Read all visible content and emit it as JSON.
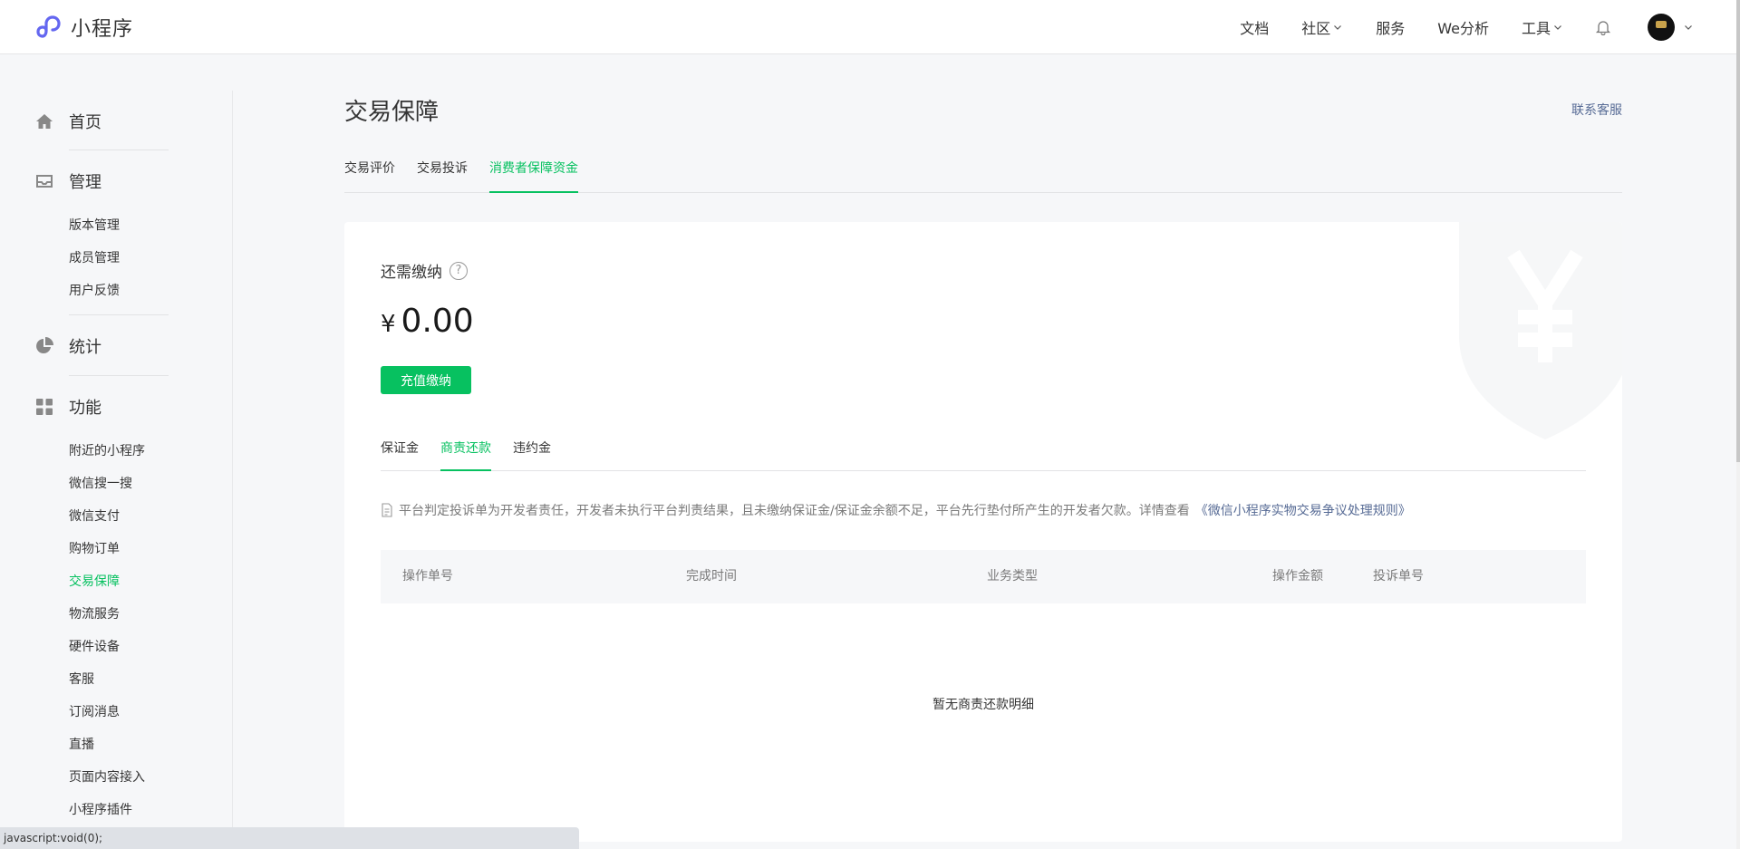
{
  "header": {
    "logo_text": "小程序",
    "nav": [
      {
        "label": "文档",
        "has_dropdown": false
      },
      {
        "label": "社区",
        "has_dropdown": true
      },
      {
        "label": "服务",
        "has_dropdown": false
      },
      {
        "label": "We分析",
        "has_dropdown": false
      },
      {
        "label": "工具",
        "has_dropdown": true
      }
    ],
    "bell_icon": "bell-icon",
    "avatar_icon": "user-avatar"
  },
  "sidebar": {
    "sections": [
      {
        "label": "首页",
        "icon": "home-icon"
      },
      {
        "label": "管理",
        "icon": "inbox-icon"
      },
      {
        "label": "统计",
        "icon": "pie-chart-icon"
      },
      {
        "label": "功能",
        "icon": "grid-icon"
      }
    ],
    "manage_items": [
      "版本管理",
      "成员管理",
      "用户反馈"
    ],
    "feature_items": [
      "附近的小程序",
      "微信搜一搜",
      "微信支付",
      "购物订单",
      "交易保障",
      "物流服务",
      "硬件设备",
      "客服",
      "订阅消息",
      "直播",
      "页面内容接入",
      "小程序插件"
    ],
    "active_item": "交易保障"
  },
  "main": {
    "title": "交易保障",
    "contact_link": "联系客服",
    "tabs": [
      "交易评价",
      "交易投诉",
      "消费者保障资金"
    ],
    "active_tab": 2
  },
  "card": {
    "due_label": "还需缴纳",
    "help_glyph": "?",
    "currency": "¥",
    "amount": "0.00",
    "pay_button": "充值缴纳",
    "tabs": [
      "保证金",
      "商责还款",
      "违约金"
    ],
    "active_tab": 1,
    "notice_text": "平台判定投诉单为开发者责任，开发者未执行平台判责结果，且未缴纳保证金/保证金余额不足，平台先行垫付所产生的开发者欠款。详情查看",
    "notice_link": "《微信小程序实物交易争议处理规则》",
    "table_headers": [
      "操作单号",
      "完成时间",
      "业务类型",
      "操作金额",
      "投诉单号"
    ],
    "empty_text": "暂无商责还款明细"
  },
  "statusbar": {
    "text": "javascript:void(0);"
  },
  "colors": {
    "accent": "#07c160",
    "link": "#576b95",
    "bg": "#f6f7f9"
  }
}
